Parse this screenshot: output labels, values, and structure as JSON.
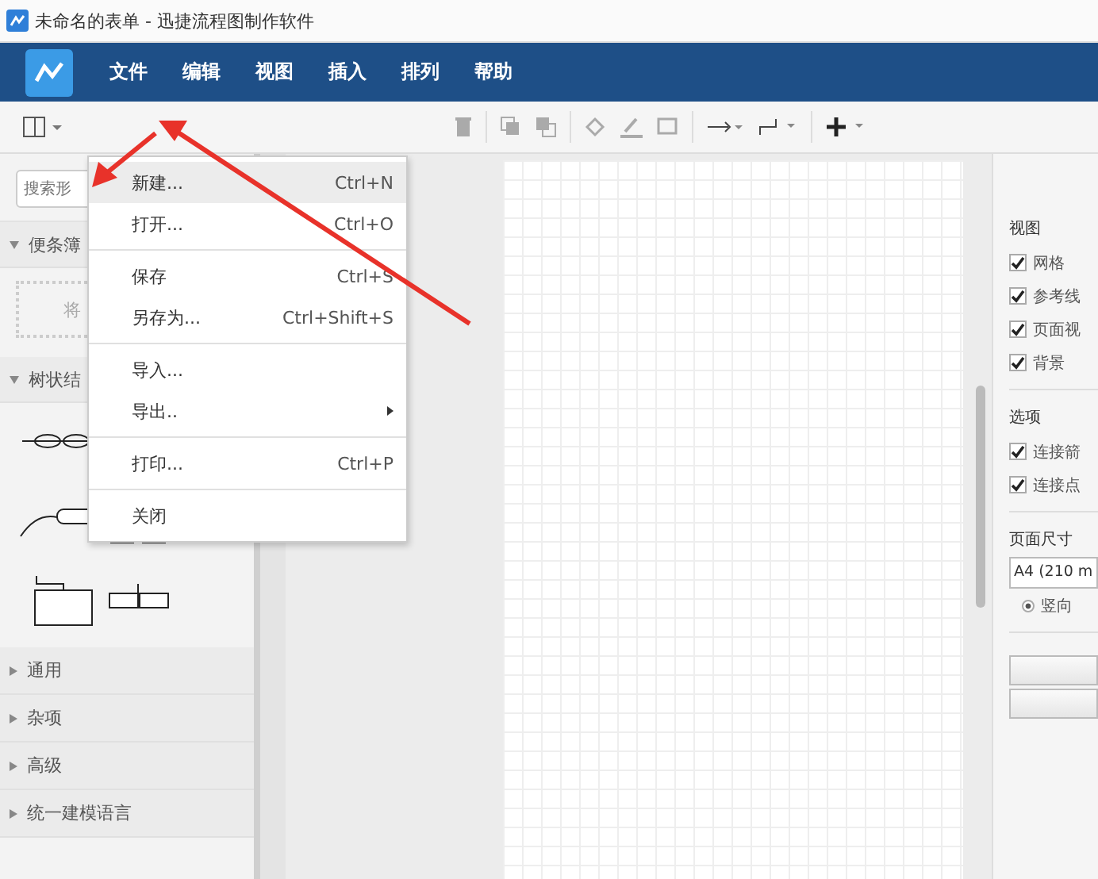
{
  "window": {
    "title": "未命名的表单 - 迅捷流程图制作软件"
  },
  "menu_bar": [
    {
      "label": "文件"
    },
    {
      "label": "编辑"
    },
    {
      "label": "视图"
    },
    {
      "label": "插入"
    },
    {
      "label": "排列"
    },
    {
      "label": "帮助"
    }
  ],
  "file_menu": [
    {
      "kind": "item",
      "label": "新建...",
      "shortcut": "Ctrl+N",
      "selected": true
    },
    {
      "kind": "item",
      "label": "打开...",
      "shortcut": "Ctrl+O",
      "selected": false
    },
    {
      "kind": "separator"
    },
    {
      "kind": "item",
      "label": "保存",
      "shortcut": "Ctrl+S",
      "selected": false
    },
    {
      "kind": "item",
      "label": "另存为...",
      "shortcut": "Ctrl+Shift+S",
      "selected": false
    },
    {
      "kind": "separator"
    },
    {
      "kind": "item",
      "label": "导入...",
      "selected": false
    },
    {
      "kind": "submenu",
      "label": "导出..",
      "selected": false
    },
    {
      "kind": "separator"
    },
    {
      "kind": "item",
      "label": "打印...",
      "shortcut": "Ctrl+P",
      "selected": false
    },
    {
      "kind": "separator"
    },
    {
      "kind": "item",
      "label": "关闭",
      "selected": false
    }
  ],
  "sidebar": {
    "search": {
      "placeholder": "搜索形"
    },
    "panels": [
      {
        "kind": "scratchpad",
        "label": "便条簿",
        "expanded": true,
        "hint": "将"
      },
      {
        "kind": "shapes",
        "label": "树状结",
        "expanded": true
      }
    ],
    "sections": [
      {
        "label": "通用",
        "expanded": false
      },
      {
        "label": "杂项",
        "expanded": false
      },
      {
        "label": "高级",
        "expanded": false
      },
      {
        "label": "统一建模语言",
        "expanded": false
      }
    ]
  },
  "format_panel": {
    "groups": [
      {
        "heading": "视图",
        "options": [
          {
            "label": "网格",
            "checked": true
          },
          {
            "label": "参考线",
            "checked": true
          },
          {
            "label": "页面视",
            "checked": true
          },
          {
            "label": "背景",
            "checked": true
          }
        ]
      },
      {
        "heading": "选项",
        "options": [
          {
            "label": "连接箭",
            "checked": true
          },
          {
            "label": "连接点",
            "checked": true
          }
        ]
      }
    ],
    "page_size": {
      "heading": "页面尺寸",
      "value": "A4 (210 m",
      "orientation": [
        {
          "label": "竖向",
          "selected": true
        }
      ]
    }
  }
}
